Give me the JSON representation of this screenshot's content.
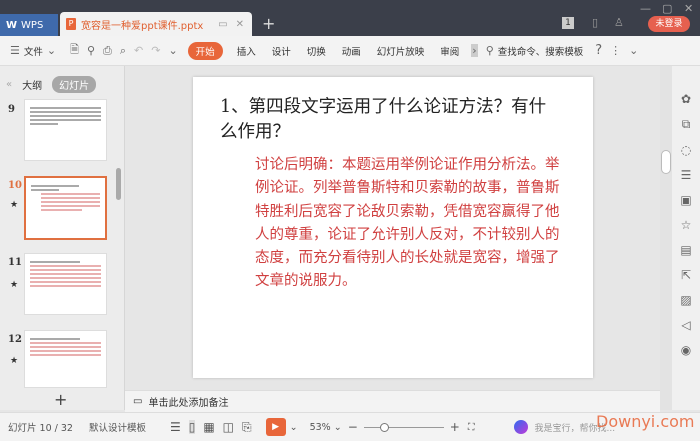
{
  "titlebar": {
    "app_tab": "WPS",
    "doc_tab": "宽容是一种爱ppt课件.pptx",
    "login": "未登录",
    "badge": "1"
  },
  "toolbar": {
    "file": "文件",
    "start": "开始",
    "items": [
      "插入",
      "设计",
      "切换",
      "动画",
      "幻灯片放映",
      "审阅"
    ],
    "search": "查找命令、搜索模板",
    "help": "?"
  },
  "panel": {
    "outline_tab": "大纲",
    "slides_tab": "幻灯片",
    "thumbnails": [
      {
        "num": "9"
      },
      {
        "num": "10",
        "selected": true
      },
      {
        "num": "11"
      },
      {
        "num": "12"
      }
    ]
  },
  "slide": {
    "title": "1、第四段文字运用了什么论证方法？有什么作用？",
    "body": "讨论后明确：本题运用举例论证作用分析法。举例论证。列举普鲁斯特和贝索勒的故事，普鲁斯特胜利后宽容了论敌贝索勒，凭借宽容赢得了他人的尊重，论证了允许别人反对，不计较别人的态度，而充分看待别人的长处就是宽容，增强了文章的说服力。",
    "title_color": "#222222",
    "body_color": "#d04040"
  },
  "notes": {
    "placeholder": "单击此处添加备注"
  },
  "status": {
    "slide_counter": "幻灯片 10 / 32",
    "template": "默认设计模板",
    "zoom": "53%",
    "zoom_level": 53,
    "assistant": "我是宝行，帮你找..."
  },
  "watermark": "Downyi.com",
  "colors": {
    "accent": "#e8663a",
    "titlebar": "#3b3f4a",
    "wps_blue": "#3f6aab"
  }
}
